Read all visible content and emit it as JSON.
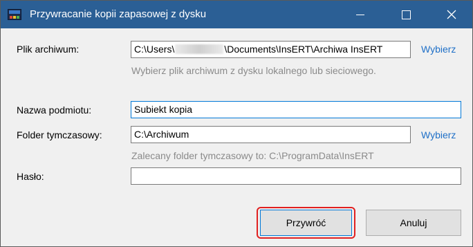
{
  "window": {
    "title": "Przywracanie kopii zapasowej z dysku"
  },
  "form": {
    "archive": {
      "label": "Plik archiwum:",
      "value_prefix": "C:\\Users\\",
      "value_suffix": "\\Documents\\InsERT\\Archiwa InsERT",
      "link": "Wybierz",
      "hint": "Wybierz plik archiwum z dysku lokalnego lub sieciowego."
    },
    "entity": {
      "label": "Nazwa podmiotu:",
      "value": "Subiekt kopia"
    },
    "temp": {
      "label": "Folder tymczasowy:",
      "value": "C:\\Archiwum",
      "link": "Wybierz",
      "hint": "Zalecany folder tymczasowy to: C:\\ProgramData\\InsERT"
    },
    "password": {
      "label": "Hasło:",
      "value": ""
    }
  },
  "buttons": {
    "restore": "Przywróć",
    "cancel": "Anuluj"
  },
  "colors": {
    "titlebar": "#2b5f95",
    "link": "#1e6fc7",
    "highlight": "#e02020",
    "focus_border": "#0078d7"
  }
}
